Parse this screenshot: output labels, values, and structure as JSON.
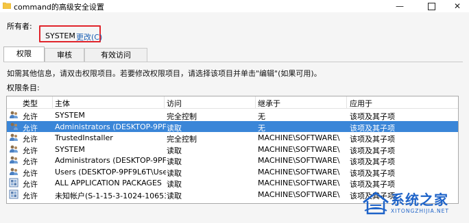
{
  "window": {
    "title": "command的高级安全设置",
    "minimize": "—",
    "close": "✕"
  },
  "owner": {
    "label": "所有者:",
    "value": "SYSTEM",
    "change_link": "更改(C)"
  },
  "tabs": [
    {
      "label": "权限",
      "active": true
    },
    {
      "label": "审核",
      "active": false
    },
    {
      "label": "有效访问",
      "active": false
    }
  ],
  "hint": "如需其他信息，请双击权限项目。若要修改权限项目，请选择该项目并单击\"编辑\"(如果可用)。",
  "entries_label": "权限条目:",
  "columns": [
    "类型",
    "主体",
    "访问",
    "继承于",
    "应用于"
  ],
  "rows": [
    {
      "icon": "users-icon",
      "type": "允许",
      "principal": "SYSTEM",
      "access": "完全控制",
      "inherited": "无",
      "applies": "该项及其子项",
      "selected": false
    },
    {
      "icon": "users-icon",
      "type": "允许",
      "principal": "Administrators (DESKTOP-9PF9L...",
      "access": "读取",
      "inherited": "无",
      "applies": "该项及其子项",
      "selected": true
    },
    {
      "icon": "users-icon",
      "type": "允许",
      "principal": "TrustedInstaller",
      "access": "完全控制",
      "inherited": "MACHINE\\SOFTWARE\\Cl...",
      "applies": "该项及其子项",
      "selected": false
    },
    {
      "icon": "users-icon",
      "type": "允许",
      "principal": "SYSTEM",
      "access": "读取",
      "inherited": "MACHINE\\SOFTWARE\\Cl...",
      "applies": "该项及其子项",
      "selected": false
    },
    {
      "icon": "users-icon",
      "type": "允许",
      "principal": "Administrators (DESKTOP-9PF9L...",
      "access": "读取",
      "inherited": "MACHINE\\SOFTWARE\\Cl...",
      "applies": "该项及其子项",
      "selected": false
    },
    {
      "icon": "users-icon",
      "type": "允许",
      "principal": "Users (DESKTOP-9PF9L6T\\Users)",
      "access": "读取",
      "inherited": "MACHINE\\SOFTWARE\\Cl...",
      "applies": "该项及其子项",
      "selected": false
    },
    {
      "icon": "app-packages-icon",
      "type": "允许",
      "principal": "ALL APPLICATION PACKAGES",
      "access": "读取",
      "inherited": "MACHINE\\SOFTWARE\\Cl...",
      "applies": "该项及其子项",
      "selected": false
    },
    {
      "icon": "app-packages-icon",
      "type": "允许",
      "principal": "未知帐户(S-1-15-3-1024-1065365...",
      "access": "读取",
      "inherited": "MACHINE\\SOFTWARE\\Cl...",
      "applies": "该项及其子项",
      "selected": false
    }
  ],
  "watermark": {
    "main": "系统之家",
    "sub": "XITONGZHIJIA.NET"
  },
  "colors": {
    "selection": "#3a86d8",
    "owner_highlight": "#e0232a",
    "link": "#1a5fb4",
    "watermark": "#1e63c8"
  }
}
